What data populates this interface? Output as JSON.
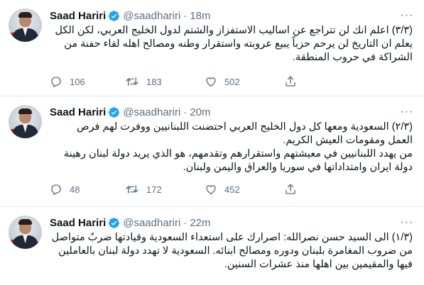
{
  "tweets": [
    {
      "name": "Saad Hariri",
      "handle": "@saadhariri",
      "separator": "·",
      "time": "18m",
      "text": [
        "(٣/٣) اعلم انك لن تتراجع عن اساليب الاستفزاز والشتم لدول الخليج العربي، لكن الكل يعلم ان التاريخ لن يرحم حزباً يبيع عروبته واستقرار وطنه ومصالح اهله لقاء حفنة من الشراكة في حروب المنطقة."
      ],
      "replies": "106",
      "retweets": "183",
      "likes": "502"
    },
    {
      "name": "Saad Hariri",
      "handle": "@saadhariri",
      "separator": "·",
      "time": "20m",
      "text": [
        "(٢/٣) السعودية ومعها كل دول الخليج العربي احتضنت اللبنانيين ووفرت لهم فرص العمل ومقومات العيش الكريم.",
        "من يهدد اللبنانيين في معيشتهم واستقرارهم وتقدمهم، هو الذي يريد دولة لبنان رهينة دولة ايران وامتداداتها  في سوريا والعراق واليمن ولبنان."
      ],
      "replies": "48",
      "retweets": "172",
      "likes": "452"
    },
    {
      "name": "Saad Hariri",
      "handle": "@saadhariri",
      "separator": "·",
      "time": "22m",
      "text": [
        "(١/٣) الى السيد حسن نصرالله: اصرارك على استعداء السعودية وقيادتها ضربٌ متواصل من ضروب المغامرة بلبنان ودوره ومصالح ابنائه. السعودية لا تهدد دولة لبنان بالعاملين فيها والمقيمين بين اهلها منذ عشرات السنين."
      ]
    }
  ],
  "icons": {
    "verified": "verified-badge-icon",
    "reply": "reply-icon",
    "retweet": "retweet-icon",
    "like": "heart-icon",
    "share": "share-icon",
    "more": "more-dots-icon"
  },
  "colors": {
    "verified": "#1da1f2",
    "secondary_text": "#5b7083",
    "divider": "#e6ecf0"
  }
}
